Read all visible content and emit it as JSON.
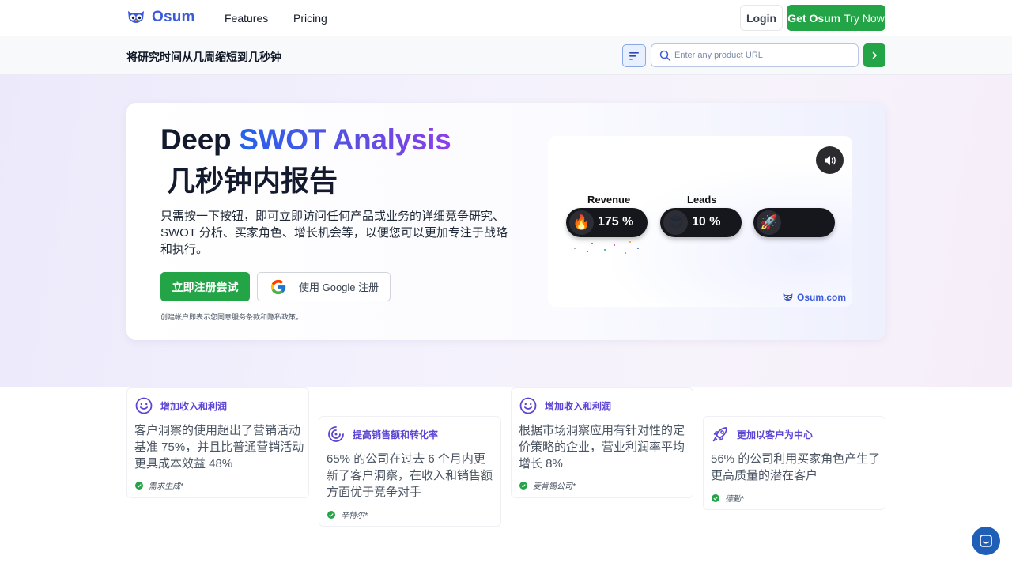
{
  "nav": {
    "brand": "Osum",
    "links": [
      "Features",
      "Pricing"
    ],
    "login": "Login",
    "try_bold": "Get Osum",
    "try_rest": "Try Now"
  },
  "subbar": {
    "title": "将研究时间从几周缩短到几秒钟",
    "search_placeholder": "Enter any product URL"
  },
  "hero": {
    "title_plain": "Deep ",
    "title_grad": "SWOT Analysis",
    "title_line2": "几秒钟内报告",
    "description": "只需按一下按钮，即可立即访问任何产品或业务的详细竞争研究、SWOT 分析、买家角色、增长机会等，以便您可以更加专注于战略和执行。",
    "signup_label": "立即注册尝试",
    "google_label": "使用 Google 注册",
    "terms": "创建帐户即表示您同意服务条款和隐私政策。"
  },
  "video": {
    "metrics": [
      {
        "label": "Revenue",
        "value": "175 %",
        "emoji": "🔥"
      },
      {
        "label": "Leads",
        "value": "10 %",
        "emoji": "😎"
      },
      {
        "label": "",
        "value": "",
        "emoji": "🚀"
      }
    ],
    "brand": "Osum.com"
  },
  "cards": [
    {
      "icon": "smile-icon",
      "title": "增加收入和利润",
      "body": "客户洞察的使用超出了营销活动基准 75%，并且比普通营销活动更具成本效益 48%",
      "source": "需求生成*"
    },
    {
      "icon": "target-icon",
      "title": "提高销售额和转化率",
      "body": "65% 的公司在过去 6 个月内更新了客户洞察，在收入和销售额方面优于竞争对手",
      "source": "辛特尔*"
    },
    {
      "icon": "smile-icon",
      "title": "增加收入和利润",
      "body": "根据市场洞察应用有针对性的定价策略的企业，营业利润率平均增长 8%",
      "source": "麦肯锡公司*"
    },
    {
      "icon": "rocket-icon",
      "title": "更加以客户为中心",
      "body": "56% 的公司利用买家角色产生了更高质量的潜在客户",
      "source": "德勤*"
    }
  ],
  "colors": {
    "accent_green": "#22a447",
    "brand_blue": "#3b5bdb",
    "card_title": "#5b45d6"
  }
}
